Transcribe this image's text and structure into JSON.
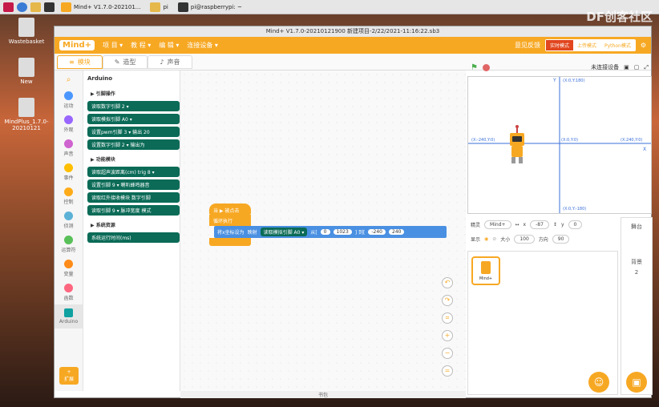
{
  "taskbar": {
    "win1": "Mind+ V1.7.0-202101...",
    "win2": "pi",
    "win3": "pi@raspberrypi: ~"
  },
  "desktop": {
    "items": [
      "Wastebasket",
      "New",
      "MindPlus_1.7.0-20210121"
    ]
  },
  "brand": "DF创客社区",
  "window": {
    "title": "Mind+ V1.7.0-20210121900  新建项目-2/22/2021-11:16:22.sb3"
  },
  "menu": {
    "logo": "Mind+",
    "items": [
      "项 目 ▾",
      "教 程 ▾",
      "编 辑 ▾",
      "连接设备 ▾"
    ],
    "feedback": "意见反馈",
    "mode_live": "实时模式",
    "mode_upload": "上传模式",
    "mode_python": "Python模式"
  },
  "tabs": [
    "模块",
    "造型",
    "声音"
  ],
  "categories": [
    {
      "label": "运动",
      "color": "#4c97ff"
    },
    {
      "label": "外观",
      "color": "#9966ff"
    },
    {
      "label": "声音",
      "color": "#cf63cf"
    },
    {
      "label": "事件",
      "color": "#ffbf00"
    },
    {
      "label": "控制",
      "color": "#ffab19"
    },
    {
      "label": "侦测",
      "color": "#5cb1d6"
    },
    {
      "label": "运算符",
      "color": "#59c059"
    },
    {
      "label": "变量",
      "color": "#ff8c1a"
    },
    {
      "label": "函数",
      "color": "#ff6680"
    },
    {
      "label": "Arduino",
      "color": "#0fa0a0"
    }
  ],
  "palette": {
    "title": "Arduino",
    "section1": "▶ 引脚操作",
    "section2": "▶ 功能模块",
    "section3": "▶ 系统资源",
    "blocks1": [
      "读取数字引脚 2 ▾",
      "读取模拟引脚 A0 ▾",
      "设置pwm引脚 3 ▾ 输出 20",
      "设置数字引脚 2 ▾ 输出为"
    ],
    "blocks2": [
      "读取超声波距离(cm) trig 8 ▾",
      "设置引脚 9 ▾ 喇叭蜂鸣器音",
      "读取红外接收模块 数字引脚",
      "读取引脚 9 ▾ 脉冲宽度 模式"
    ],
    "blocks3": [
      "系统运行时间(ms)"
    ]
  },
  "script": {
    "hat": "当 ▶ 被点击",
    "loop": "循环执行",
    "set": "将x坐标设为",
    "map": "映射",
    "read": "读取模拟引脚 A0 ▾",
    "from": "从[",
    "v0": "0",
    "v1": "1023",
    "to": "] 到[",
    "v2": "-240",
    "v3": "240"
  },
  "ext": "扩展",
  "bottom": "书包",
  "stage": {
    "connect": "未连接设备",
    "coord_top": "(X:0,Y:180)",
    "coord_left": "(X:-240,Y:0)",
    "coord_center": "(X:0,Y:0)",
    "coord_right": "(X:240,Y:0)",
    "coord_bottom": "(X:0,Y:-180)",
    "axis_y": "Y",
    "axis_x": "X"
  },
  "sprite_info": {
    "label": "精灵",
    "name": "Mind+",
    "x_label": "x",
    "x": "-87",
    "y_label": "y",
    "y": "0",
    "show": "显示",
    "size_label": "大小",
    "size": "100",
    "dir_label": "方向",
    "dir": "90"
  },
  "sprite": {
    "name": "Mind+"
  },
  "stage_panel": {
    "title": "舞台",
    "bg": "背景",
    "count": "2"
  }
}
